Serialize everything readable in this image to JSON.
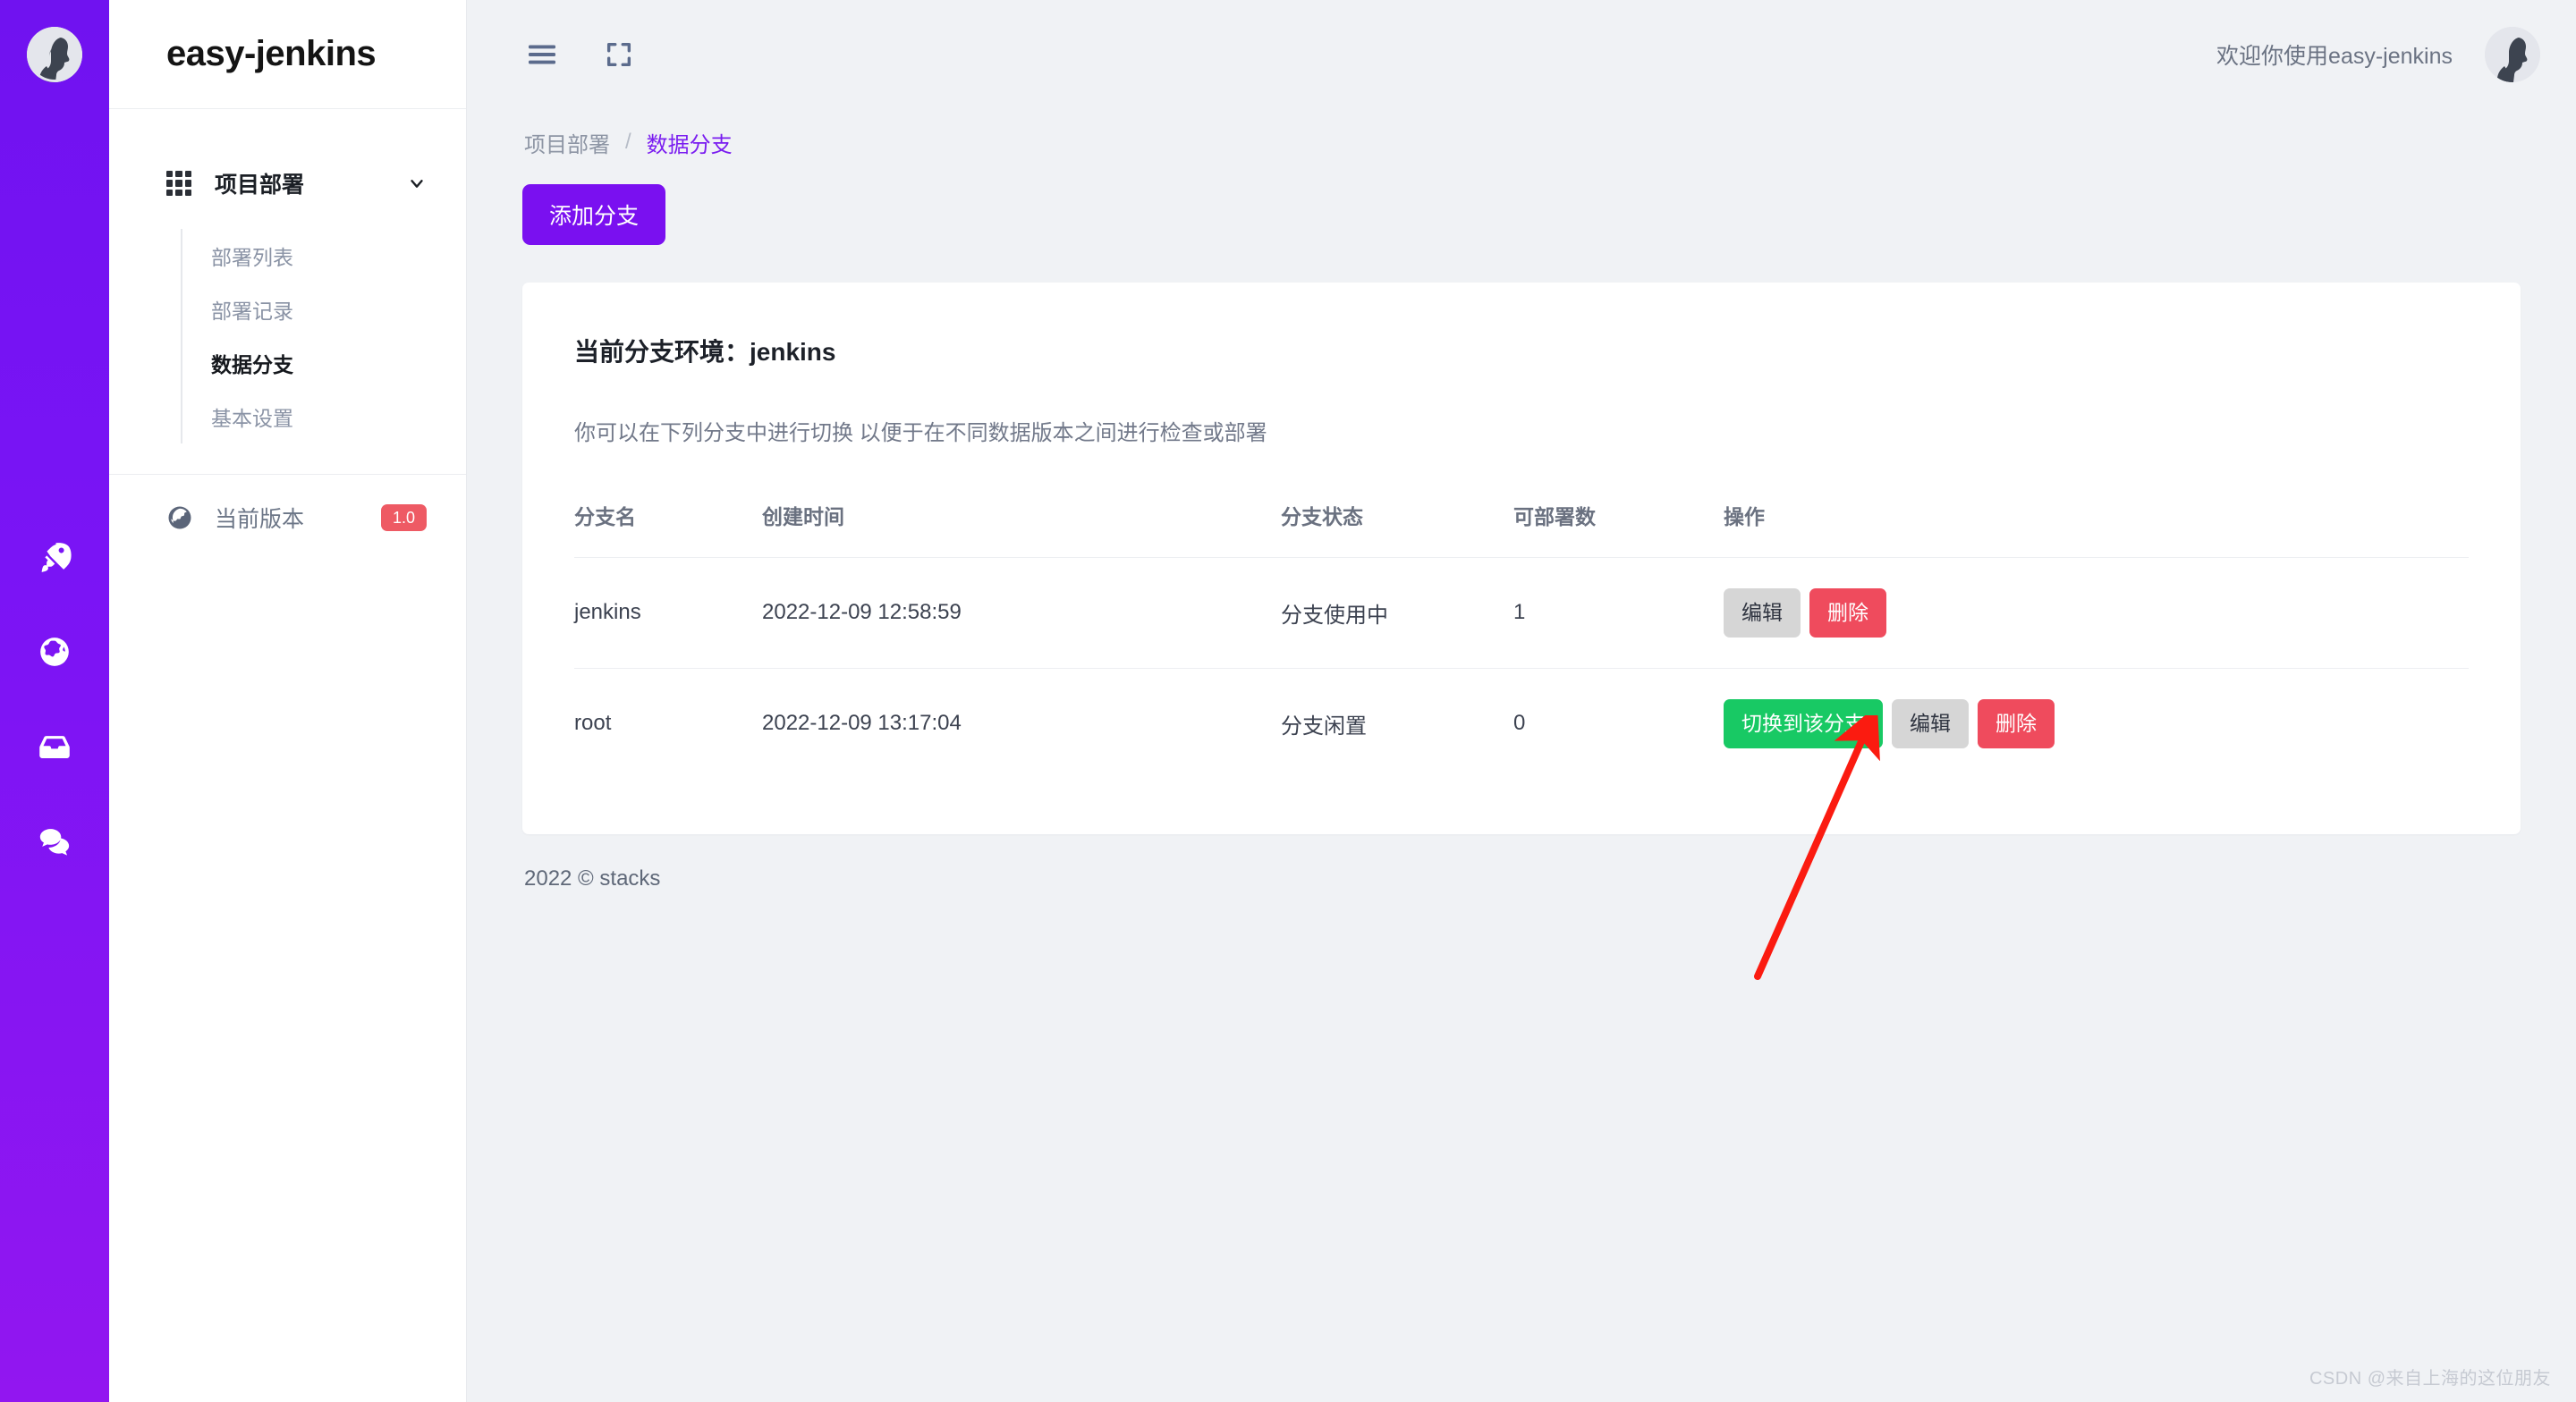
{
  "brand": {
    "title": "easy-jenkins",
    "avatar_icon": "user-avatar"
  },
  "rail": {
    "icons": [
      {
        "name": "rocket-icon",
        "label": "rocket"
      },
      {
        "name": "globe-icon",
        "label": "globe"
      },
      {
        "name": "inbox-icon",
        "label": "inbox"
      },
      {
        "name": "chat-icon",
        "label": "chat"
      }
    ]
  },
  "sidebar": {
    "group": {
      "label": "项目部署",
      "icon": "grid-icon",
      "chevron": "chevron-down-icon"
    },
    "items": [
      {
        "label": "部署列表",
        "active": false
      },
      {
        "label": "部署记录",
        "active": false
      },
      {
        "label": "数据分支",
        "active": true
      },
      {
        "label": "基本设置",
        "active": false
      }
    ],
    "footer": {
      "label": "当前版本",
      "icon": "globe-icon",
      "badge": "1.0",
      "badge_color": "#ee5a64"
    }
  },
  "topbar": {
    "menu_icon": "hamburger-menu-icon",
    "fullscreen_icon": "fullscreen-icon",
    "welcome": "欢迎你使用easy-jenkins",
    "avatar_icon": "user-avatar"
  },
  "breadcrumb": {
    "root": "项目部署",
    "separator": "/",
    "current": "数据分支"
  },
  "actions": {
    "add_branch": "添加分支"
  },
  "card": {
    "title": "当前分支环境：jenkins",
    "description": "你可以在下列分支中进行切换 以便于在不同数据版本之间进行检查或部署"
  },
  "table": {
    "columns": [
      "分支名",
      "创建时间",
      "分支状态",
      "可部署数",
      "操作"
    ],
    "rows": [
      {
        "name": "jenkins",
        "created": "2022-12-09 12:58:59",
        "status": "分支使用中",
        "deploy_count": "1",
        "buttons": [
          {
            "label": "编辑",
            "style": "edit"
          },
          {
            "label": "删除",
            "style": "delete"
          }
        ]
      },
      {
        "name": "root",
        "created": "2022-12-09 13:17:04",
        "status": "分支闲置",
        "deploy_count": "0",
        "buttons": [
          {
            "label": "切换到该分支",
            "style": "switch"
          },
          {
            "label": "编辑",
            "style": "edit"
          },
          {
            "label": "删除",
            "style": "delete"
          }
        ]
      }
    ]
  },
  "footer": {
    "copyright": "2022 © stacks"
  },
  "watermark": {
    "text": "CSDN @来自上海的这位朋友"
  },
  "colors": {
    "brand_purple": "#7a10f0",
    "accent_link": "#7a1df0",
    "btn_switch_green": "#18c964",
    "btn_delete_red": "#ef4b5d",
    "btn_edit_gray": "#d6d6d6",
    "badge_red": "#ee5a64",
    "page_bg": "#f0f2f5",
    "annotation_red": "#fb1b10"
  }
}
